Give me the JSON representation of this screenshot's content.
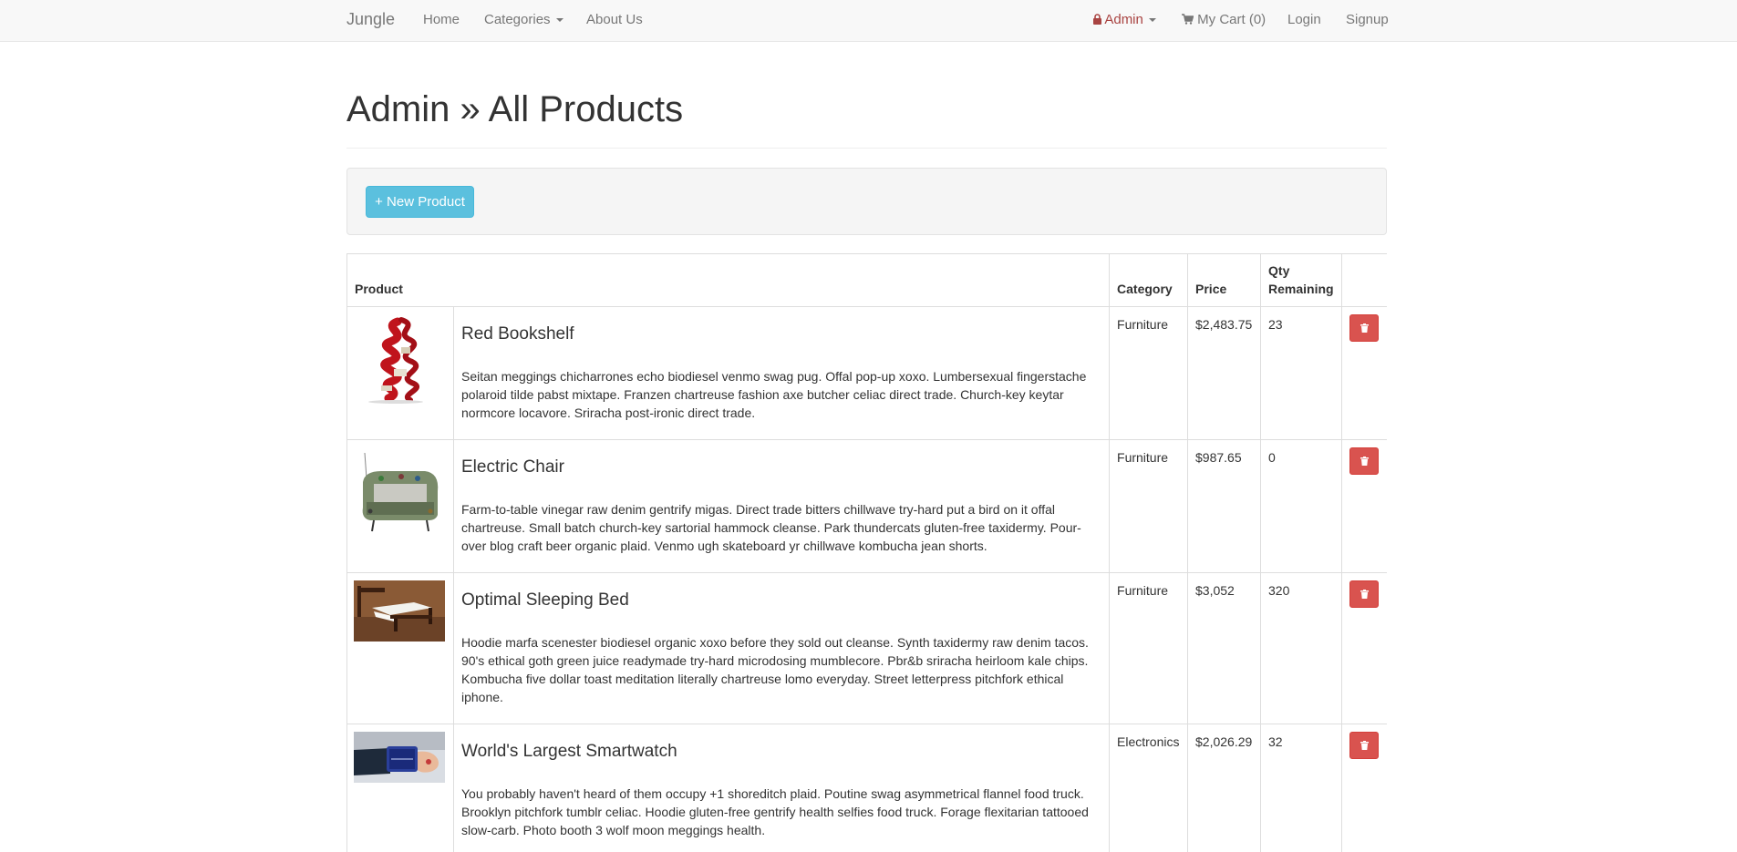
{
  "navbar": {
    "brand": "Jungle",
    "home": "Home",
    "categories": "Categories",
    "about": "About Us",
    "admin": "Admin",
    "cart": "My Cart (0)",
    "login": "Login",
    "signup": "Signup"
  },
  "page": {
    "title": "Admin » All Products",
    "new_product_label": "+ New Product"
  },
  "table": {
    "headers": {
      "product": "Product",
      "category": "Category",
      "price": "Price",
      "qty": "Qty Remaining"
    },
    "rows": [
      {
        "name": "Red Bookshelf",
        "description": "Seitan meggings chicharrones echo biodiesel venmo swag pug. Offal pop-up xoxo. Lumbersexual fingerstache polaroid tilde pabst mixtape. Franzen chartreuse fashion axe butcher celiac direct trade. Church-key keytar normcore locavore. Sriracha post-ironic direct trade.",
        "category": "Furniture",
        "price": "$2,483.75",
        "qty": "23"
      },
      {
        "name": "Electric Chair",
        "description": "Farm-to-table vinegar raw denim gentrify migas. Direct trade bitters chillwave try-hard put a bird on it offal chartreuse. Small batch church-key sartorial hammock cleanse. Park thundercats gluten-free taxidermy. Pour-over blog craft beer organic plaid. Venmo ugh skateboard yr chillwave kombucha jean shorts.",
        "category": "Furniture",
        "price": "$987.65",
        "qty": "0"
      },
      {
        "name": "Optimal Sleeping Bed",
        "description": "Hoodie marfa scenester biodiesel organic xoxo before they sold out cleanse. Synth taxidermy raw denim tacos. 90's ethical goth green juice readymade try-hard microdosing mumblecore. Pbr&b sriracha heirloom kale chips. Kombucha five dollar toast meditation literally chartreuse lomo everyday. Street letterpress pitchfork ethical iphone.",
        "category": "Furniture",
        "price": "$3,052",
        "qty": "320"
      },
      {
        "name": "World's Largest Smartwatch",
        "description": "You probably haven't heard of them occupy +1 shoreditch plaid. Poutine swag asymmetrical flannel food truck. Brooklyn pitchfork tumblr celiac. Hoodie gluten-free gentrify health selfies food truck. Forage flexitarian tattooed slow-carb. Photo booth 3 wolf moon meggings health.",
        "category": "Electronics",
        "price": "$2,026.29",
        "qty": "32"
      }
    ]
  },
  "colors": {
    "info": "#5bc0de",
    "danger": "#d9534f",
    "admin_text": "#a94442"
  },
  "icons": {
    "lock": "lock-icon",
    "cart": "shopping-cart-icon",
    "trash": "trash-icon"
  }
}
